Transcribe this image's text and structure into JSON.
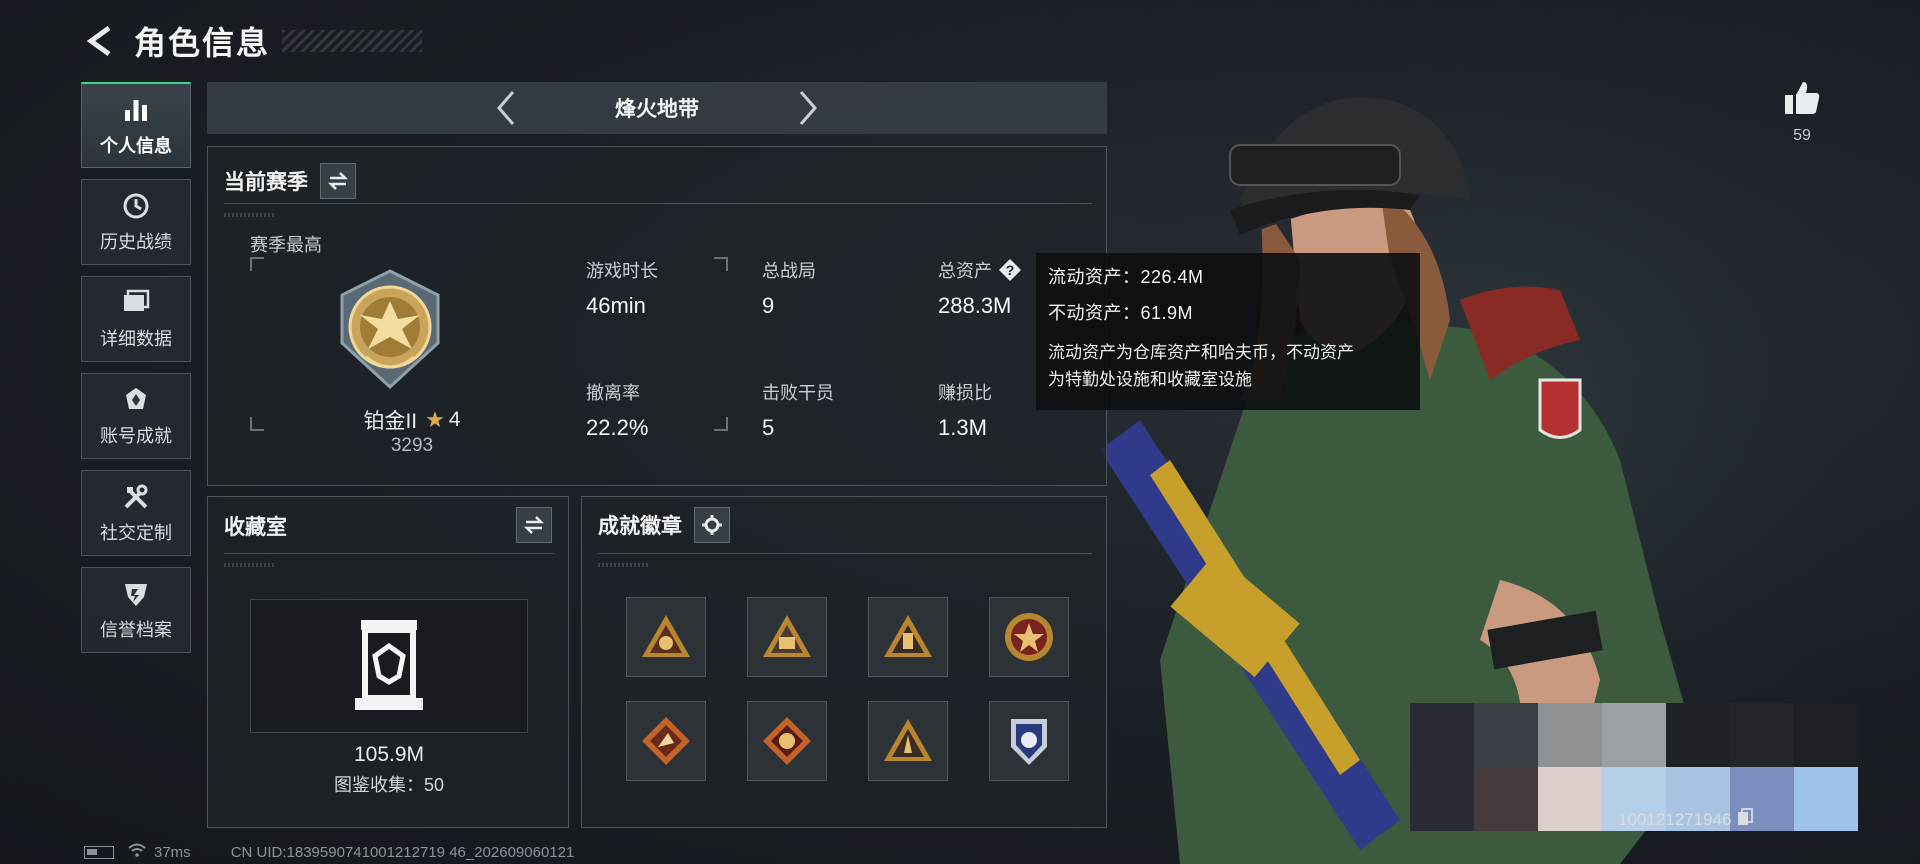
{
  "header": {
    "title": "角色信息"
  },
  "sidebar": {
    "items": [
      {
        "label": "个人信息",
        "icon": "bar-chart-icon"
      },
      {
        "label": "历史战绩",
        "icon": "history-clock-icon"
      },
      {
        "label": "详细数据",
        "icon": "folder-icon"
      },
      {
        "label": "账号成就",
        "icon": "achievement-icon"
      },
      {
        "label": "社交定制",
        "icon": "tools-icon"
      },
      {
        "label": "信誉档案",
        "icon": "shield-icon"
      }
    ]
  },
  "mode_selector": {
    "title": "烽火地带"
  },
  "season": {
    "title": "当前赛季",
    "best_label": "赛季最高",
    "rank_name": "铂金II",
    "rank_stars": "4",
    "rank_points": "3293",
    "stats": [
      {
        "label": "游戏时长",
        "value": "46min"
      },
      {
        "label": "总战局",
        "value": "9"
      },
      {
        "label": "总资产",
        "value": "288.3M"
      },
      {
        "label": "撤离率",
        "value": "22.2%"
      },
      {
        "label": "击败干员",
        "value": "5"
      },
      {
        "label": "赚损比",
        "value": "1.3M"
      }
    ]
  },
  "tooltip": {
    "line1": "流动资产：226.4M",
    "line2": "不动资产：61.9M",
    "desc1": "流动资产为仓库资产和哈夫币，不动资产",
    "desc2": "为特勤处设施和收藏室设施"
  },
  "collection": {
    "title": "收藏室",
    "value": "105.9M",
    "collected": "图鉴收集：50"
  },
  "badges": {
    "title": "成就徽章",
    "items": [
      "badge-1",
      "badge-2",
      "badge-3",
      "badge-4",
      "badge-5",
      "badge-6",
      "badge-7",
      "badge-8"
    ]
  },
  "likes": {
    "count": "59"
  },
  "status_bar": {
    "ping": "37ms",
    "uid": "CN UID:1839590741001212719 46_202609060121",
    "uid_short": "100121271946"
  },
  "colors": {
    "accent_green": "#3ed38a",
    "gold": "#c9a45a"
  }
}
